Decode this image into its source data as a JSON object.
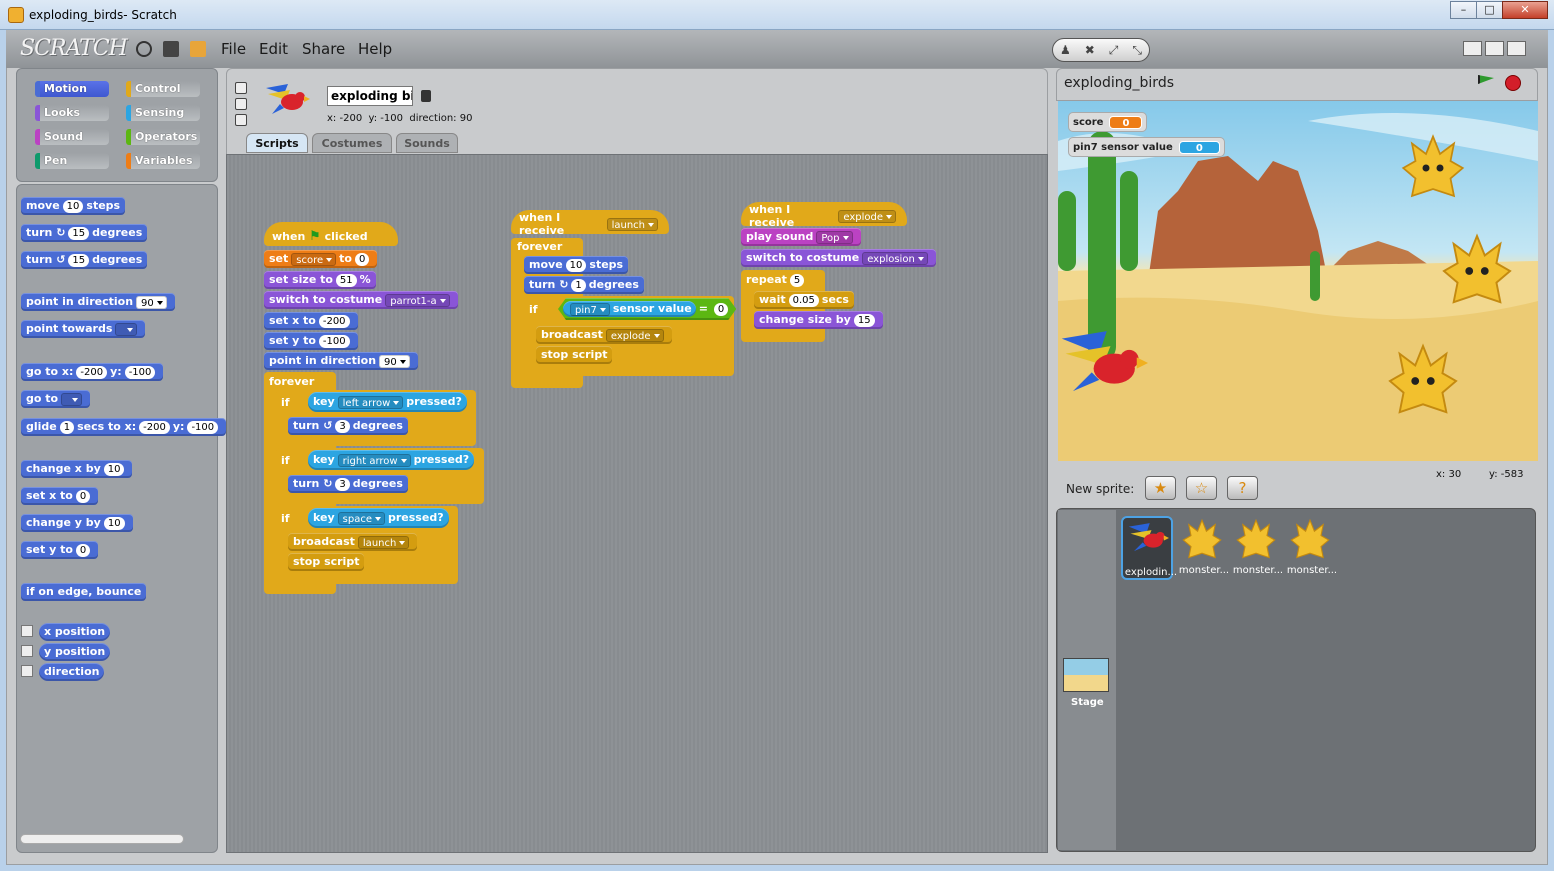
{
  "window": {
    "title": "exploding_birds- Scratch",
    "min": "–",
    "max": "□",
    "close": "✕"
  },
  "menu": {
    "logo": "SCRATCH",
    "file": "File",
    "edit": "Edit",
    "share": "Share",
    "help": "Help"
  },
  "categories": {
    "motion": "Motion",
    "control": "Control",
    "looks": "Looks",
    "sensing": "Sensing",
    "sound": "Sound",
    "operators": "Operators",
    "pen": "Pen",
    "variables": "Variables"
  },
  "colors": {
    "motion": "#4a6cd4",
    "control": "#e1a91a",
    "looks": "#8a55d7",
    "sensing": "#2ca5e2",
    "sound": "#bb42c3",
    "operators": "#5cb712",
    "pen": "#0e9a6c",
    "variables": "#ee7d16"
  },
  "palette": {
    "move": "move",
    "move_val": "10",
    "steps": "steps",
    "turn": "turn",
    "turn_cw_val": "15",
    "turn_ccw_val": "15",
    "degrees": "degrees",
    "point_dir": "point in direction",
    "point_dir_val": "90",
    "point_towards": "point towards",
    "goto_xy": "go to x:",
    "goto_x": "-200",
    "y": "y:",
    "goto_y": "-100",
    "goto": "go to",
    "glide": "glide",
    "glide_secs": "1",
    "secs_to_x": "secs to x:",
    "glide_x": "-200",
    "glide_y": "-100",
    "change_x": "change x by",
    "change_x_val": "10",
    "set_x": "set x to",
    "set_x_val": "0",
    "change_y": "change y by",
    "change_y_val": "10",
    "set_y": "set y to",
    "set_y_val": "0",
    "bounce": "if on edge, bounce",
    "x_position": "x position",
    "y_position": "y position",
    "direction": "direction"
  },
  "sprite": {
    "name": "exploding bi",
    "x": "-200",
    "y": "-100",
    "direction": "90",
    "x_label": "x:",
    "y_label": "y:",
    "dir_label": "direction:"
  },
  "tabs": {
    "scripts": "Scripts",
    "costumes": "Costumes",
    "sounds": "Sounds"
  },
  "script1": {
    "when": "when",
    "clicked": "clicked",
    "set": "set",
    "set_var": "score",
    "to": "to",
    "set_val": "0",
    "set_size": "set size to",
    "size_val": "51",
    "pct": "%",
    "switch_costume": "switch to costume",
    "costume": "parrot1-a",
    "set_x": "set x to",
    "x_val": "-200",
    "set_y": "set y to",
    "y_val": "-100",
    "point_dir": "point in direction",
    "dir_val": "90",
    "forever": "forever",
    "if": "if",
    "key": "key",
    "pressed": "pressed?",
    "key1": "left arrow",
    "key2": "right arrow",
    "key3": "space",
    "turn": "turn",
    "turn_val": "3",
    "degrees": "degrees",
    "broadcast": "broadcast",
    "bcast_msg": "launch",
    "stop_script": "stop script"
  },
  "script2": {
    "when_receive": "when I receive",
    "msg": "launch",
    "forever": "forever",
    "move": "move",
    "move_val": "10",
    "steps": "steps",
    "turn": "turn",
    "turn_val": "1",
    "degrees": "degrees",
    "if": "if",
    "sensor": "pin7",
    "sensor_value": "sensor value",
    "eq": "=",
    "cmp_val": "0",
    "broadcast": "broadcast",
    "bcast_msg": "explode",
    "stop_script": "stop script"
  },
  "script3": {
    "when_receive": "when I receive",
    "msg": "explode",
    "play_sound": "play sound",
    "sound": "Pop",
    "switch_costume": "switch to costume",
    "costume": "explosion",
    "repeat": "repeat",
    "repeat_val": "5",
    "wait": "wait",
    "wait_val": "0.05",
    "secs": "secs",
    "change_size": "change size by",
    "size_val": "15"
  },
  "stage": {
    "name": "exploding_birds",
    "mouse_x": "x: 30",
    "mouse_y": "y: -583"
  },
  "monitors": {
    "score_label": "score",
    "score_val": "0",
    "pin7_label": "pin7 sensor value",
    "pin7_val": "0"
  },
  "newsprite": {
    "label": "New sprite:"
  },
  "sprites": [
    {
      "label": "explodin...",
      "selected": true
    },
    {
      "label": "monster..."
    },
    {
      "label": "monster..."
    },
    {
      "label": "monster..."
    }
  ],
  "stage_thumb_label": "Stage"
}
